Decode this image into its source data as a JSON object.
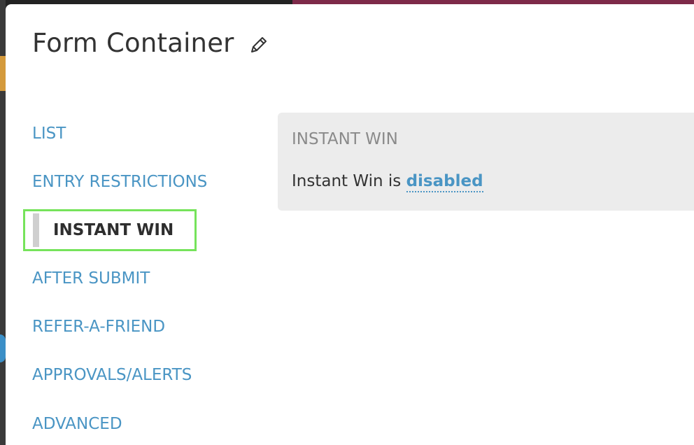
{
  "modal": {
    "title": "Form Container"
  },
  "nav": {
    "items": [
      {
        "label": "LIST"
      },
      {
        "label": "ENTRY RESTRICTIONS"
      },
      {
        "label": "INSTANT WIN",
        "active": true
      },
      {
        "label": "AFTER SUBMIT"
      },
      {
        "label": "REFER-A-FRIEND"
      },
      {
        "label": "APPROVALS/ALERTS"
      },
      {
        "label": "ADVANCED"
      }
    ]
  },
  "panel": {
    "heading": "INSTANT WIN",
    "text_prefix": "Instant Win is ",
    "status_link": "disabled"
  },
  "icons": {
    "edit": "pencil-icon"
  },
  "colors": {
    "link": "#4a95c4",
    "active_highlight": "#76e35b",
    "panel_bg": "#ececec"
  }
}
